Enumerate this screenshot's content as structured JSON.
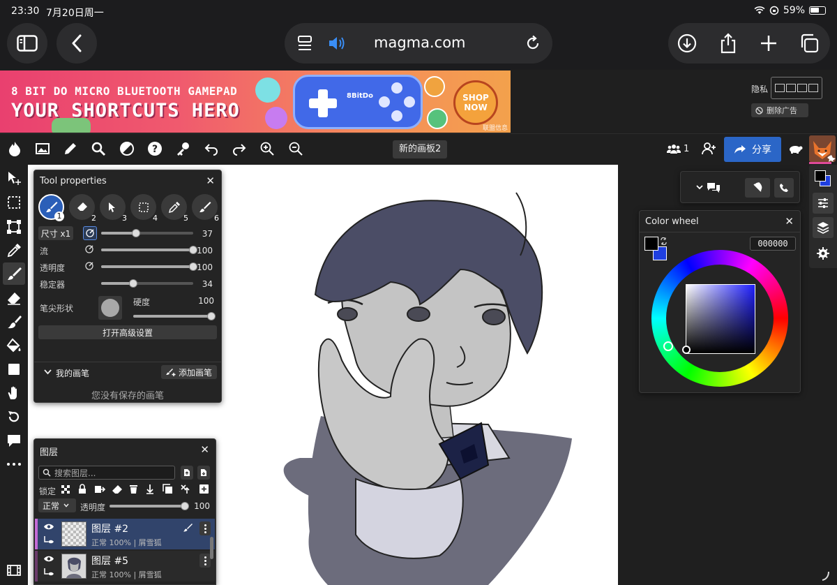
{
  "status": {
    "time": "23:30",
    "date": "7月20日周一",
    "battery": "59%"
  },
  "browser": {
    "url": "magma.com"
  },
  "ad": {
    "line1": "8 BIT DO MICRO BLUETOOTH GAMEPAD",
    "line2": "YOUR SHORTCUTS HERO",
    "brand": "8BitDo",
    "shop_label": "SHOP NOW",
    "info_label": "联盟信息",
    "hide_label": "隐私",
    "remove_label": "删除广告"
  },
  "toolbar": {
    "board_name": "新的画板2",
    "users_count": "1",
    "share_label": "分享"
  },
  "tool_properties": {
    "title": "Tool properties",
    "brush_slots": [
      "1",
      "2",
      "3",
      "4",
      "5",
      "6"
    ],
    "size_label": "尺寸 x1",
    "size_value": 37,
    "flow_label": "流",
    "flow_value": 100,
    "opacity_label": "透明度",
    "opacity_value": 100,
    "stabilizer_label": "稳定器",
    "stabilizer_value": 34,
    "tip_shape_label": "笔尖形状",
    "hardness_label": "硬度",
    "hardness_value": 100,
    "advanced_label": "打开高级设置",
    "my_brushes_label": "我的画笔",
    "add_brush_label": "添加画笔",
    "no_brushes_label": "您没有保存的画笔"
  },
  "layers": {
    "title": "图层",
    "search_placeholder": "搜索图层...",
    "lock_label": "锁定",
    "blend_mode": "正常",
    "opacity_label": "透明度",
    "opacity_value": 100,
    "items": [
      {
        "name": "图层 #2",
        "sub": "正常 100% | 屑雪狐",
        "selected": true
      },
      {
        "name": "图层 #5",
        "sub": "正常 100% | 屑雪狐",
        "selected": false
      }
    ]
  },
  "color_wheel": {
    "title": "Color wheel",
    "hex": "000000",
    "primary": "#000000",
    "secondary": "#1f3fe0"
  }
}
